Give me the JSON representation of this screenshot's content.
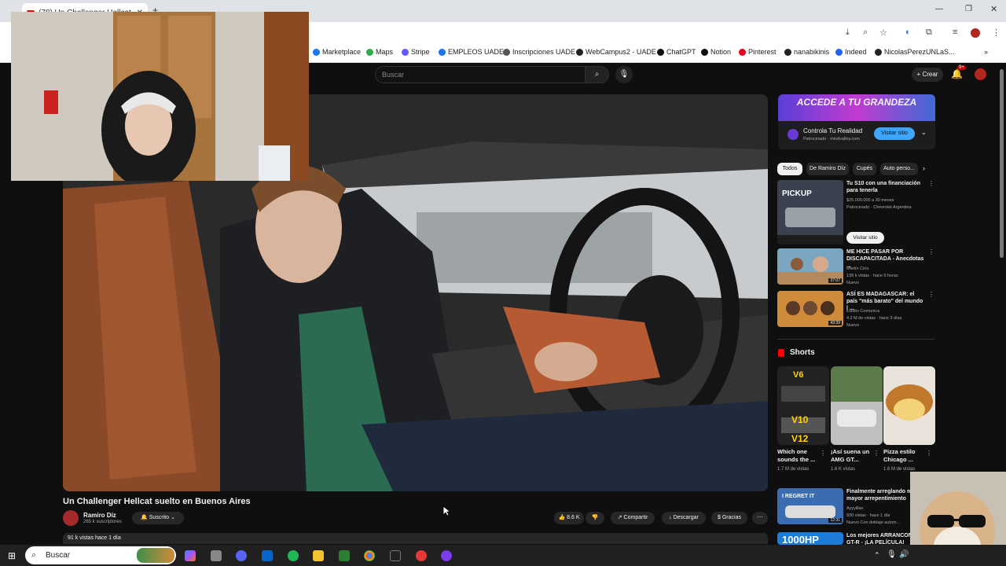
{
  "tab": {
    "title": "(78) Un Challenger Hellcat"
  },
  "bookmarks": [
    {
      "label": "Marketplace",
      "color": "#1877f2"
    },
    {
      "label": "Maps",
      "color": "#34a853"
    },
    {
      "label": "Stripe",
      "color": "#635bff"
    },
    {
      "label": "EMPLEOS UADE",
      "color": "#1a73e8"
    },
    {
      "label": "Inscripciones UADE",
      "color": "#555555"
    },
    {
      "label": "WebCampus2 - UADE",
      "color": "#222222"
    },
    {
      "label": "ChatGPT",
      "color": "#111111"
    },
    {
      "label": "Notion",
      "color": "#111111"
    },
    {
      "label": "Pinterest",
      "color": "#e60023"
    },
    {
      "label": "nanabikinis",
      "color": "#222222"
    },
    {
      "label": "Indeed",
      "color": "#2164f3"
    },
    {
      "label": "NicolasPerezUNLaS...",
      "color": "#222222"
    }
  ],
  "header": {
    "search_placeholder": "Buscar",
    "create_label": "Crear",
    "bell_badge": "9+"
  },
  "video": {
    "title": "Un Challenger Hellcat suelto en Buenos Aires",
    "channel": "Ramiro Díz",
    "subscribers": "265 k suscriptores",
    "subscribed_label": "Suscrito",
    "likes": "8.6 K",
    "share_label": "Compartir",
    "download_label": "Descargar",
    "thanks_label": "Gracias",
    "views_date": "91 k vistas  hace 1 día"
  },
  "ad": {
    "banner": "ACCEDE A TU GRANDEZA",
    "title": "Controla Tu Realidad",
    "sponsor": "Patrocinado · mindvalley.com",
    "cta": "Visitar sitio"
  },
  "chips": [
    "Todos",
    "De Ramiro Díz",
    "Cupés",
    "Auto perso..."
  ],
  "related": [
    {
      "title": "Tu S10 con una financiación para tenerla",
      "meta1": "$25.000.000 a 30 meses",
      "meta2": "Patrocinado · Chevrolet Argentina",
      "cta": "Visitar sitio",
      "duration": ""
    },
    {
      "title": "ME HICE PASAR POR DISCAPACITADA - Anecdotas ...",
      "meta1": "Martín Cirio",
      "meta2": "138 k vistas · hace 9 horas",
      "badge": "Nuevo",
      "duration": "37:07"
    },
    {
      "title": "ASÍ ES MADAGASCAR: el país \"más barato\" del mundo | ...",
      "meta1": "Luisito Comunica",
      "meta2": "4.2 M de vistas · hace 3 días",
      "badge": "Nuevo",
      "duration": "43:39"
    }
  ],
  "shorts": {
    "section_title": "Shorts",
    "items": [
      {
        "title": "Which one sounds the ...",
        "views": "1.7 M de vistas",
        "overlay": "V6 / V12"
      },
      {
        "title": "¡Así suena un AMG GT...",
        "views": "1.6 K vistas",
        "overlay": ""
      },
      {
        "title": "Pizza estilo Chicago ...",
        "views": "1.6 M de vistas",
        "overlay": ""
      }
    ]
  },
  "more": [
    {
      "title": "Finalmente arreglando mi mayor arrepentimiento",
      "meta1": "Ayyyillan",
      "meta2": "930 vistas · hace 1 día",
      "meta3": "Nuevo   Con doblaje autom...",
      "duration": "12:31",
      "overlay": "I REGRET IT"
    },
    {
      "title": "Los mejores ARRANCONES GT-R - ¡LA PELÍCULA!",
      "overlay": "1000HP"
    }
  ],
  "taskbar": {
    "search_label": "Buscar"
  }
}
